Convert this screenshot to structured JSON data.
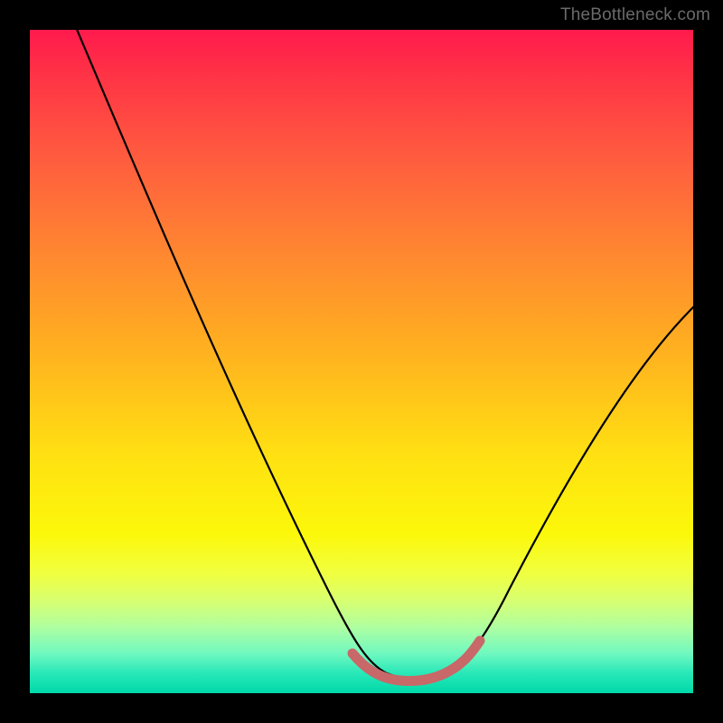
{
  "watermark": "TheBottleneck.com",
  "chart_data": {
    "type": "line",
    "title": "",
    "xlabel": "",
    "ylabel": "",
    "xlim": [
      0,
      100
    ],
    "ylim": [
      0,
      100
    ],
    "series": [
      {
        "name": "curve",
        "x": [
          10,
          15,
          20,
          25,
          30,
          35,
          40,
          45,
          50,
          52,
          54,
          56,
          58,
          60,
          62,
          64,
          66,
          70,
          75,
          80,
          85,
          90,
          95,
          100
        ],
        "y": [
          100,
          89,
          78,
          67,
          56,
          45,
          34,
          23,
          12,
          8,
          5,
          3,
          2,
          2,
          2,
          3,
          5,
          10,
          18,
          27,
          36,
          44,
          52,
          58
        ]
      }
    ],
    "highlight_segment": {
      "x_start": 52,
      "x_end": 66,
      "y": 2
    },
    "background_gradient": {
      "stops": [
        {
          "pos": 0.0,
          "color": "#ff1a4d"
        },
        {
          "pos": 0.5,
          "color": "#ffd400"
        },
        {
          "pos": 0.85,
          "color": "#eaff40"
        },
        {
          "pos": 1.0,
          "color": "#00d8a8"
        }
      ]
    }
  }
}
